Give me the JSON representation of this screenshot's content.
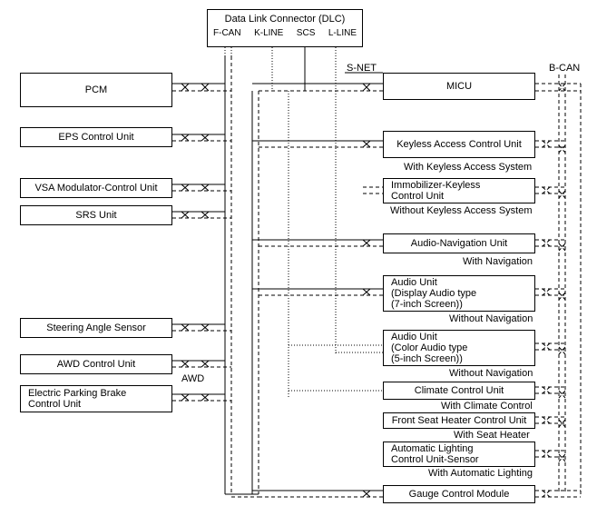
{
  "dlc": {
    "title": "Data Link Connector (DLC)",
    "ports": {
      "fcan": "F-CAN",
      "kline": "K-LINE",
      "scs": "SCS",
      "lline": "L-LINE"
    }
  },
  "bus": {
    "snet": "S-NET",
    "bcan": "B-CAN",
    "awd": "AWD"
  },
  "left_modules": {
    "pcm": "PCM",
    "eps": "EPS Control Unit",
    "vsa": "VSA Modulator-Control Unit",
    "srs": "SRS Unit",
    "steering": "Steering Angle Sensor",
    "awd_ctrl": "AWD Control Unit",
    "epb": "Electric Parking Brake\nControl Unit"
  },
  "right_modules": {
    "micu": "MICU",
    "keyless": "Keyless Access Control Unit",
    "immobilizer": "Immobilizer-Keyless\nControl Unit",
    "audio_nav": "Audio-Navigation Unit",
    "audio_disp": "Audio Unit\n(Display Audio type\n(7-inch Screen))",
    "audio_color": "Audio Unit\n(Color Audio type\n(5-inch Screen))",
    "climate": "Climate Control Unit",
    "seat_heater": "Front Seat Heater Control Unit",
    "auto_light": "Automatic Lighting\nControl Unit-Sensor",
    "gauge": "Gauge Control Module"
  },
  "conditions": {
    "with_keyless": "With Keyless Access System",
    "without_keyless": "Without Keyless Access System",
    "with_nav": "With Navigation",
    "without_nav1": "Without Navigation",
    "without_nav2": "Without Navigation",
    "with_climate": "With Climate Control",
    "with_seat_heater": "With Seat Heater",
    "with_auto_light": "With Automatic Lighting"
  }
}
